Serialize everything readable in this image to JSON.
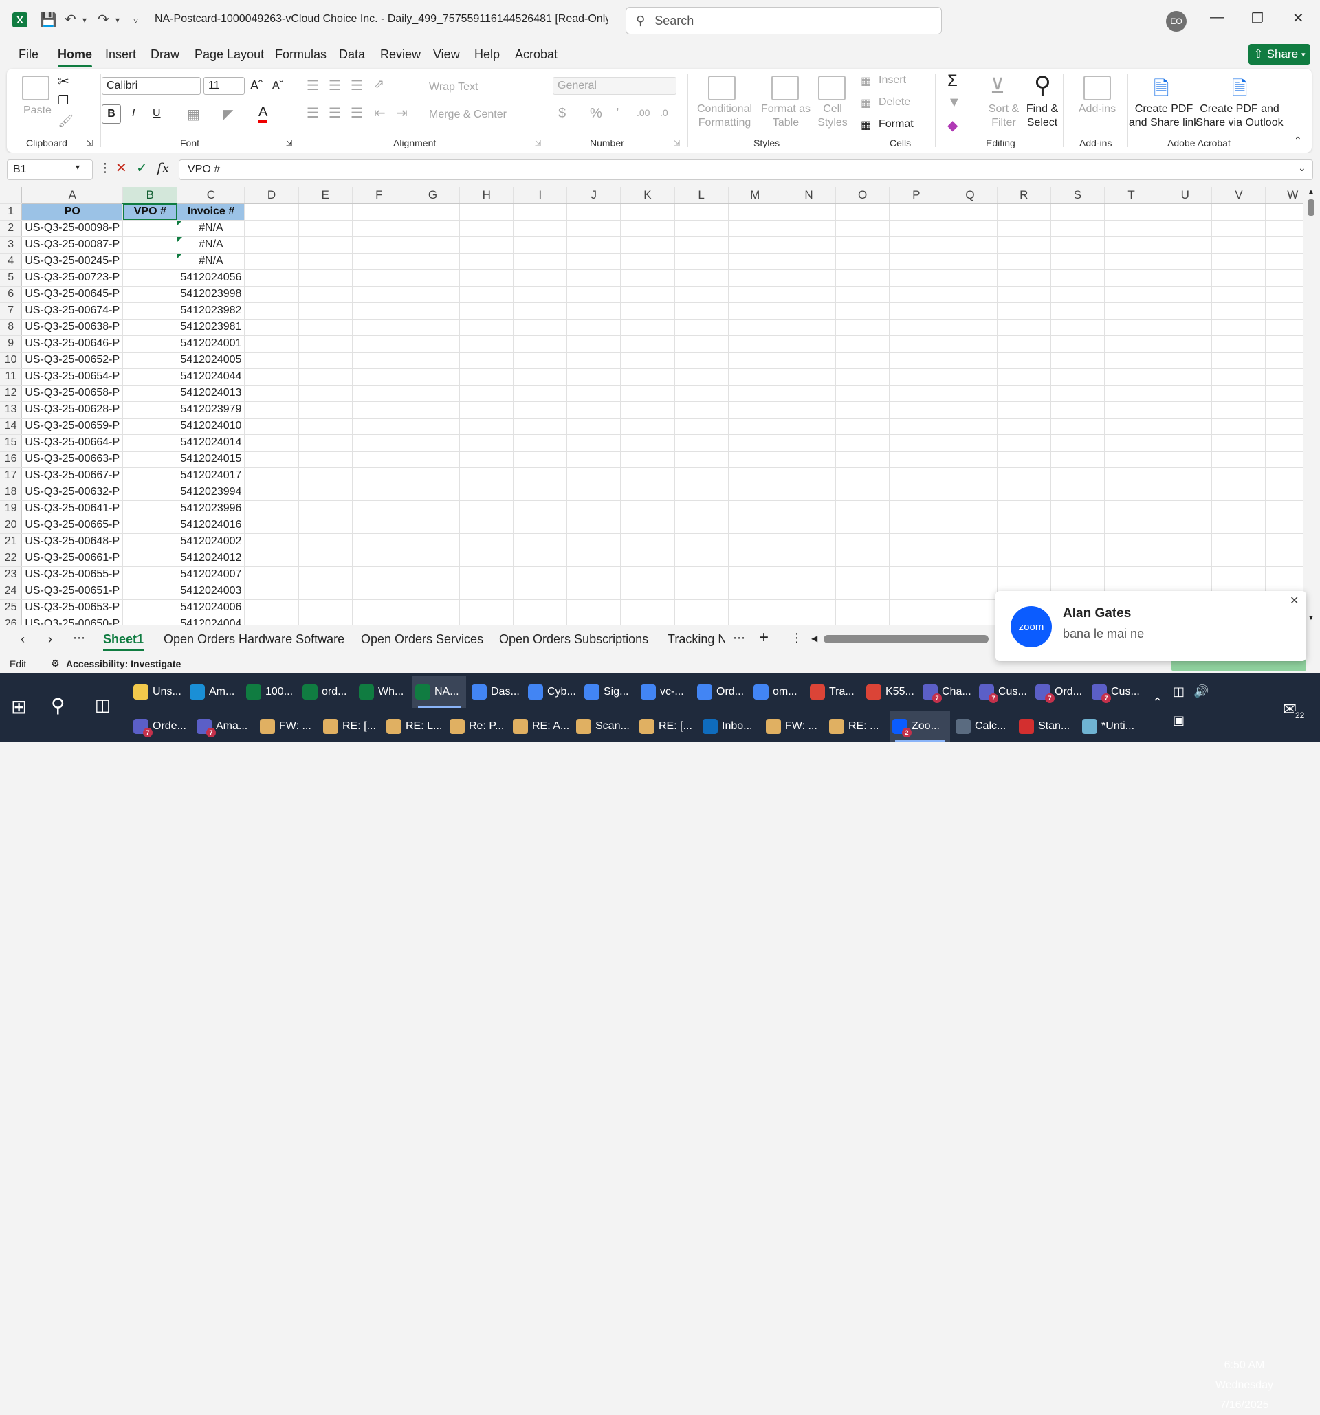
{
  "window": {
    "doc_title": "NA-Postcard-1000049263-vCloud Choice Inc. - Daily_499_757559116144526481  [Read-Only]  -  E...",
    "search_placeholder": "Search",
    "avatar_initials": "EO"
  },
  "menu": {
    "items": [
      "File",
      "Home",
      "Insert",
      "Draw",
      "Page Layout",
      "Formulas",
      "Data",
      "Review",
      "View",
      "Help",
      "Acrobat"
    ],
    "active": "Home",
    "share_label": "Share"
  },
  "ribbon": {
    "clipboard": {
      "label": "Clipboard",
      "paste": "Paste"
    },
    "font": {
      "label": "Font",
      "family": "Calibri",
      "size": "11"
    },
    "alignment": {
      "label": "Alignment",
      "wrap_text": "Wrap Text",
      "merge_center": "Merge & Center"
    },
    "number": {
      "label": "Number",
      "format": "General"
    },
    "styles": {
      "label": "Styles",
      "conditional_formatting": [
        "Conditional",
        "Formatting"
      ],
      "format_as_table": [
        "Format as",
        "Table"
      ],
      "cell_styles": [
        "Cell",
        "Styles"
      ]
    },
    "cells": {
      "label": "Cells",
      "insert": "Insert",
      "delete": "Delete",
      "format": "Format"
    },
    "editing": {
      "label": "Editing",
      "sort_filter": [
        "Sort &",
        "Filter"
      ],
      "find_select": [
        "Find &",
        "Select"
      ]
    },
    "addins": {
      "label": "Add-ins",
      "addins_btn": "Add-ins"
    },
    "acrobat": {
      "label": "Adobe Acrobat",
      "create_pdf_share": [
        "Create PDF",
        "and Share link"
      ],
      "create_pdf_outlook": [
        "Create PDF and",
        "Share via Outlook"
      ]
    }
  },
  "formula_bar": {
    "name_box": "B1",
    "content": "VPO #"
  },
  "sheet": {
    "columns": [
      "A",
      "B",
      "C",
      "D",
      "E",
      "F",
      "G",
      "H",
      "I",
      "J",
      "K",
      "L",
      "M",
      "N",
      "O",
      "P",
      "Q",
      "R",
      "S",
      "T",
      "U",
      "V",
      "W"
    ],
    "headers": [
      "PO",
      "VPO #",
      "Invoice #"
    ],
    "rows": [
      [
        "US-Q3-25-00098-P",
        "#N/A"
      ],
      [
        "US-Q3-25-00087-P",
        "#N/A"
      ],
      [
        "US-Q3-25-00245-P",
        "#N/A"
      ],
      [
        "US-Q3-25-00723-P",
        "5412024056"
      ],
      [
        "US-Q3-25-00645-P",
        "5412023998"
      ],
      [
        "US-Q3-25-00674-P",
        "5412023982"
      ],
      [
        "US-Q3-25-00638-P",
        "5412023981"
      ],
      [
        "US-Q3-25-00646-P",
        "5412024001"
      ],
      [
        "US-Q3-25-00652-P",
        "5412024005"
      ],
      [
        "US-Q3-25-00654-P",
        "5412024044"
      ],
      [
        "US-Q3-25-00658-P",
        "5412024013"
      ],
      [
        "US-Q3-25-00628-P",
        "5412023979"
      ],
      [
        "US-Q3-25-00659-P",
        "5412024010"
      ],
      [
        "US-Q3-25-00664-P",
        "5412024014"
      ],
      [
        "US-Q3-25-00663-P",
        "5412024015"
      ],
      [
        "US-Q3-25-00667-P",
        "5412024017"
      ],
      [
        "US-Q3-25-00632-P",
        "5412023994"
      ],
      [
        "US-Q3-25-00641-P",
        "5412023996"
      ],
      [
        "US-Q3-25-00665-P",
        "5412024016"
      ],
      [
        "US-Q3-25-00648-P",
        "5412024002"
      ],
      [
        "US-Q3-25-00661-P",
        "5412024012"
      ],
      [
        "US-Q3-25-00655-P",
        "5412024007"
      ],
      [
        "US-Q3-25-00651-P",
        "5412024003"
      ],
      [
        "US-Q3-25-00653-P",
        "5412024006"
      ],
      [
        "US-Q3-25-00650-P",
        "5412024004"
      ]
    ]
  },
  "sheet_tabs": {
    "tabs": [
      "Sheet1",
      "Open Orders Hardware Software",
      "Open Orders Services",
      "Open Orders Subscriptions",
      "Tracking N"
    ],
    "active": "Sheet1"
  },
  "status": {
    "mode": "Edit",
    "accessibility": "Accessibility: Investigate"
  },
  "toast": {
    "name": "Alan Gates",
    "message": "bana le mai ne",
    "logo": "zoom"
  },
  "taskbar": {
    "row1": [
      {
        "label": "Uns...",
        "icon": "folder",
        "color": "#f2c94c"
      },
      {
        "label": "Am...",
        "icon": "edge",
        "color": "#1a8fd6"
      },
      {
        "label": "100...",
        "icon": "excel",
        "color": "#107c41"
      },
      {
        "label": "ord...",
        "icon": "excel",
        "color": "#107c41"
      },
      {
        "label": "Wh...",
        "icon": "excel",
        "color": "#107c41"
      },
      {
        "label": "NA...",
        "icon": "excel",
        "color": "#107c41",
        "active": true
      },
      {
        "label": "Das...",
        "icon": "chrome",
        "color": "#4285f4"
      },
      {
        "label": "Cyb...",
        "icon": "chrome",
        "color": "#4285f4"
      },
      {
        "label": "Sig...",
        "icon": "chrome",
        "color": "#4285f4"
      },
      {
        "label": "vc-...",
        "icon": "chrome",
        "color": "#4285f4"
      },
      {
        "label": "Ord...",
        "icon": "chrome",
        "color": "#4285f4"
      },
      {
        "label": "om...",
        "icon": "chrome",
        "color": "#4285f4"
      },
      {
        "label": "Tra...",
        "icon": "chrome",
        "color": "#db4437"
      },
      {
        "label": "K55...",
        "icon": "chrome",
        "color": "#db4437"
      },
      {
        "label": "Cha...",
        "icon": "teams",
        "color": "#5b5fc7",
        "badge": "7"
      },
      {
        "label": "Cus...",
        "icon": "teams",
        "color": "#5b5fc7",
        "badge": "7"
      },
      {
        "label": "Ord...",
        "icon": "teams",
        "color": "#5b5fc7",
        "badge": "7"
      },
      {
        "label": "Cus...",
        "icon": "teams",
        "color": "#5b5fc7",
        "badge": "7"
      }
    ],
    "row2": [
      {
        "label": "Orde...",
        "icon": "teams",
        "color": "#5b5fc7",
        "badge": "7"
      },
      {
        "label": "Ama...",
        "icon": "teams",
        "color": "#5b5fc7",
        "badge": "7"
      },
      {
        "label": "FW: ...",
        "icon": "mail",
        "color": "#e0b062"
      },
      {
        "label": "RE: [...",
        "icon": "mail",
        "color": "#e0b062"
      },
      {
        "label": "RE: L...",
        "icon": "mail",
        "color": "#e0b062"
      },
      {
        "label": "Re: P...",
        "icon": "mail",
        "color": "#e0b062"
      },
      {
        "label": "RE: A...",
        "icon": "mail",
        "color": "#e0b062"
      },
      {
        "label": "Scan...",
        "icon": "mail",
        "color": "#e0b062"
      },
      {
        "label": "RE: [...",
        "icon": "mail",
        "color": "#e0b062"
      },
      {
        "label": "Inbo...",
        "icon": "outlook",
        "color": "#0f6cbd"
      },
      {
        "label": "FW: ...",
        "icon": "mail",
        "color": "#e0b062"
      },
      {
        "label": "RE: ...",
        "icon": "mail",
        "color": "#e0b062"
      },
      {
        "label": "Zoo...",
        "icon": "zoom",
        "color": "#0b5cff",
        "badge": "2",
        "active": true
      },
      {
        "label": "Calc...",
        "icon": "calculator",
        "color": "#5a6b80"
      },
      {
        "label": "Stan...",
        "icon": "pdf",
        "color": "#d32f2f"
      },
      {
        "label": "*Unti...",
        "icon": "notepad",
        "color": "#6fb3d2"
      }
    ],
    "clock": {
      "time": "6:50 AM",
      "day": "Wednesday",
      "date": "7/16/2025"
    },
    "notification_count": "22"
  }
}
